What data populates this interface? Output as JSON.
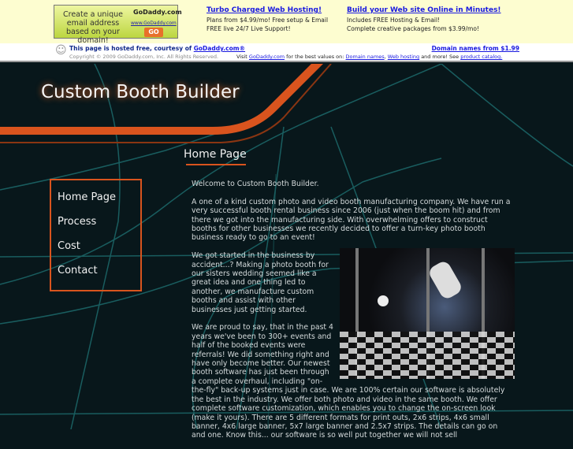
{
  "ad": {
    "box": {
      "text": "Create a unique email address based on your domain!",
      "logo": "GoDaddy.com",
      "url": "www.GoDaddy.com",
      "go": "GO"
    },
    "col1": {
      "title": "Turbo Charged Web Hosting!",
      "line1": "Plans from $4.99/mo! Free setup & Email",
      "line2": "FREE live 24/7 Live Support!"
    },
    "col2": {
      "title": "Build your Web site Online in Minutes!",
      "line1": "Includes FREE Hosting & Email!",
      "line2": "Complete creative packages from $3.99/mo!"
    }
  },
  "host": {
    "line1": "This page is hosted free, courtesy of ",
    "godaddy": "GoDaddy.com®",
    "copyright": "Copyright © 2009 GoDaddy.com, Inc. All Rights Reserved.",
    "visit": "Visit ",
    "visit_link": "GoDaddy.com",
    "best": " for the best values on: ",
    "domain_link": "Domain names",
    "comma": ", ",
    "hosting_link": "Web hosting",
    "more": " and more! See ",
    "catalog_link": "product catalog.",
    "right_link": "Domain names from $1.99"
  },
  "site": {
    "title": "Custom Booth Builder",
    "heading": "Home Page"
  },
  "nav": [
    "Home Page",
    "Process",
    "Cost",
    "Contact"
  ],
  "content": {
    "p1": "Welcome to Custom Booth Builder.",
    "p2": "A one of a kind custom photo and video booth manufacturing company. We have run a very successful booth rental business since 2006 (just when the boom hit) and from there we got into the manufacturing side. With overwhelming offers to construct booths for other businesses we recently decided to offer a turn-key photo booth business ready to go to an event!",
    "p3": "We got started in the business by accident...? Making a photo booth for our sisters wedding seemed like a great idea and one thing led to another, we manufacture custom booths and assist with other businesses just getting started.",
    "p4": "We are proud to say, that in the past 4 years we've been to 300+ events and half of the booked events were referrals! We did something right and have only become better. Our newest booth software has just been through a complete overhaul, including \"on-the-fly\" back-up systems just in case. We are 100% certain our software is absolutely the best in the industry. We offer both photo and video in the same booth. We offer complete software customization, which enables you to change the on-screen look (make it yours). There are 5 different formats for print outs, 2x6 strips, 4x6 small banner, 4x6 large banner, 5x7 large banner and 2.5x7 strips. The details can go on and one. Know this... our software is so well put together we will not sell"
  },
  "colors": {
    "accent": "#d9541e",
    "background": "#08171b",
    "lines": "#1e6f70"
  }
}
